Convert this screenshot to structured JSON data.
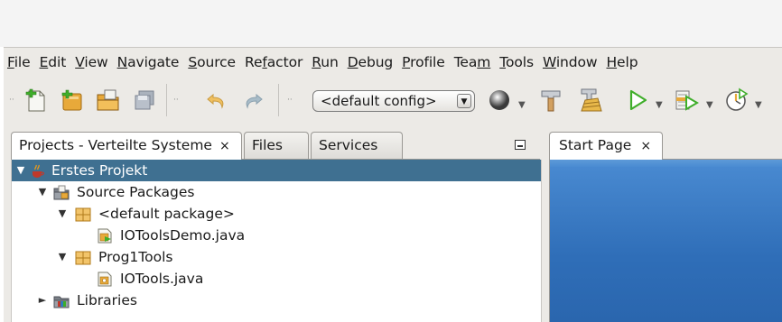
{
  "menu": [
    {
      "label": "File",
      "mnemonic": "F"
    },
    {
      "label": "Edit",
      "mnemonic": "E"
    },
    {
      "label": "View",
      "mnemonic": "V"
    },
    {
      "label": "Navigate",
      "mnemonic": "N"
    },
    {
      "label": "Source",
      "mnemonic": "S"
    },
    {
      "label": "Refactor",
      "mnemonic": "f"
    },
    {
      "label": "Run",
      "mnemonic": "R"
    },
    {
      "label": "Debug",
      "mnemonic": "D"
    },
    {
      "label": "Profile",
      "mnemonic": "P"
    },
    {
      "label": "Team",
      "mnemonic": "m"
    },
    {
      "label": "Tools",
      "mnemonic": "T"
    },
    {
      "label": "Window",
      "mnemonic": "W"
    },
    {
      "label": "Help",
      "mnemonic": "H"
    }
  ],
  "toolbar": {
    "config_value": "<default config>",
    "icons": [
      "new-file-icon",
      "new-project-icon",
      "open-project-icon",
      "save-all-icon",
      "undo-icon",
      "redo-icon",
      "browser-icon",
      "build-icon",
      "clean-build-icon",
      "run-icon",
      "debug-icon",
      "profile-icon"
    ]
  },
  "projects_panel": {
    "tabs": [
      "Projects - Verteilte Systeme",
      "Files",
      "Services"
    ],
    "close_glyph": "×",
    "tree": [
      {
        "label": "Erstes Projekt",
        "icon": "java-project-icon",
        "expanded": true,
        "selected": true
      },
      {
        "label": "Source Packages",
        "icon": "source-folder-icon",
        "expanded": true
      },
      {
        "label": "<default package>",
        "icon": "package-icon",
        "expanded": true
      },
      {
        "label": "IOToolsDemo.java",
        "icon": "java-main-class-icon"
      },
      {
        "label": "Prog1Tools",
        "icon": "package-icon",
        "expanded": true
      },
      {
        "label": "IOTools.java",
        "icon": "java-class-icon"
      },
      {
        "label": "Libraries",
        "icon": "library-folder-icon",
        "expanded": false
      }
    ]
  },
  "editor": {
    "tab_label": "Start Page",
    "close_glyph": "×"
  },
  "colors": {
    "selection": "#3f7091",
    "start_page_blue": "#2f6eb8",
    "run_green": "#3fae2a",
    "package_orange": "#e8a93a"
  }
}
